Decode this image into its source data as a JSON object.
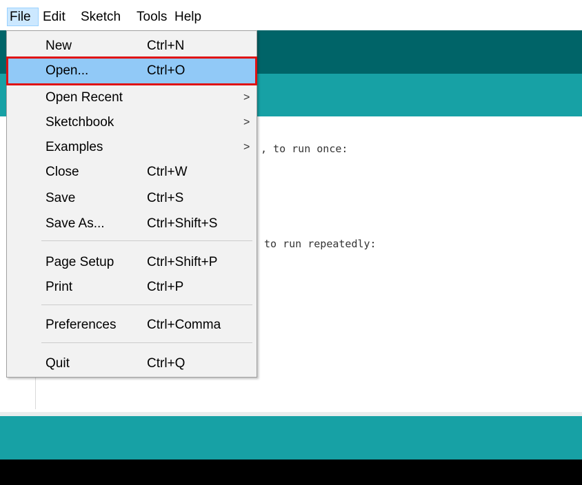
{
  "menubar": {
    "items": [
      {
        "label": "File"
      },
      {
        "label": "Edit"
      },
      {
        "label": "Sketch"
      },
      {
        "label": "Tools"
      },
      {
        "label": "Help"
      }
    ]
  },
  "file_menu": {
    "items": [
      {
        "label": "New",
        "shortcut": "Ctrl+N"
      },
      {
        "label": "Open...",
        "shortcut": "Ctrl+O",
        "highlighted": true
      },
      {
        "label": "Open Recent",
        "submenu_arrow": ">"
      },
      {
        "label": "Sketchbook",
        "submenu_arrow": ">"
      },
      {
        "label": "Examples",
        "submenu_arrow": ">"
      },
      {
        "label": "Close",
        "shortcut": "Ctrl+W"
      },
      {
        "label": "Save",
        "shortcut": "Ctrl+S"
      },
      {
        "label": "Save As...",
        "shortcut": "Ctrl+Shift+S"
      },
      {
        "label": "Page Setup",
        "shortcut": "Ctrl+Shift+P"
      },
      {
        "label": "Print",
        "shortcut": "Ctrl+P"
      },
      {
        "label": "Preferences",
        "shortcut": "Ctrl+Comma"
      },
      {
        "label": "Quit",
        "shortcut": "Ctrl+Q"
      }
    ]
  },
  "editor": {
    "code_line_1": ", to run once:",
    "code_line_2": " to run repeatedly:"
  },
  "colors": {
    "toolbar": "#006468",
    "tabbar": "#17a1a5",
    "highlight": "#91c9f7",
    "annotation_box": "#e01010"
  }
}
